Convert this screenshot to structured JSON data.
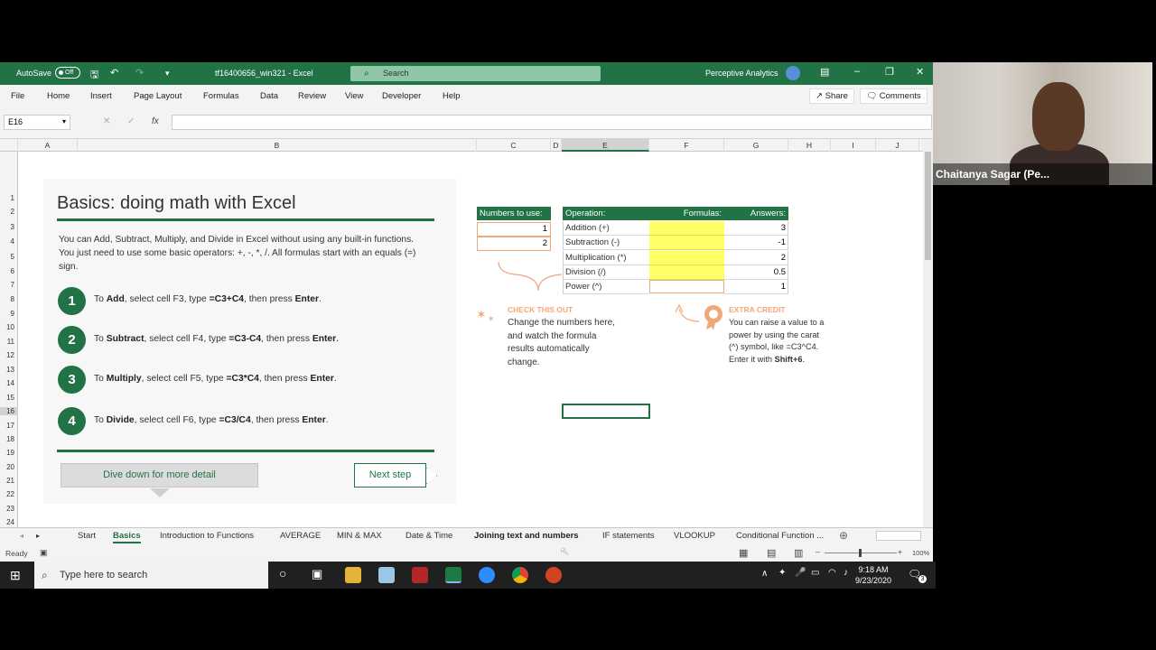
{
  "titlebar": {
    "autosave_label": "AutoSave",
    "autosave_state": "Off",
    "filename": "tf16400656_win321  -  Excel",
    "search_placeholder": "Search",
    "user_name": "Perceptive Analytics"
  },
  "menu": {
    "items": [
      "File",
      "Home",
      "Insert",
      "Page Layout",
      "Formulas",
      "Data",
      "Review",
      "View",
      "Developer",
      "Help"
    ],
    "share_label": "Share",
    "comments_label": "Comments"
  },
  "formula_bar": {
    "name_box": "E16",
    "fx": "fx",
    "value": ""
  },
  "columns": [
    "A",
    "B",
    "C",
    "D",
    "E",
    "F",
    "G",
    "H",
    "I",
    "J"
  ],
  "rows": [
    "1",
    "2",
    "3",
    "4",
    "5",
    "6",
    "7",
    "8",
    "9",
    "10",
    "11",
    "12",
    "13",
    "14",
    "15",
    "16",
    "17",
    "18",
    "19",
    "20",
    "21",
    "22",
    "23",
    "24"
  ],
  "panel": {
    "title": "Basics: doing math with Excel",
    "intro": "You can Add, Subtract, Multiply, and Divide in Excel without using any built-in functions. You just need to use some basic operators: +, -, *, /. All formulas start with an equals (=) sign.",
    "steps": [
      {
        "num": "1",
        "pre": "To ",
        "verb": "Add",
        "mid": ", select cell F3, type ",
        "formula": "=C3+C4",
        "post": ", then press ",
        "key": "Enter",
        "end": "."
      },
      {
        "num": "2",
        "pre": "To ",
        "verb": "Subtract",
        "mid": ", select cell F4, type ",
        "formula": "=C3-C4",
        "post": ", then press ",
        "key": "Enter",
        "end": "."
      },
      {
        "num": "3",
        "pre": "To ",
        "verb": "Multiply",
        "mid": ", select cell F5, type ",
        "formula": "=C3*C4",
        "post": ", then press ",
        "key": "Enter",
        "end": "."
      },
      {
        "num": "4",
        "pre": "To ",
        "verb": "Divide",
        "mid": ", select cell F6, type ",
        "formula": "=C3/C4",
        "post": ", then press ",
        "key": "Enter",
        "end": "."
      }
    ],
    "dive_button": "Dive down for more detail",
    "next_button": "Next step"
  },
  "numbers_table": {
    "header": "Numbers to use:",
    "values": [
      "1",
      "2"
    ]
  },
  "ops_table": {
    "headers": {
      "operation": "Operation:",
      "formulas": "Formulas:",
      "answers": "Answers:"
    },
    "rows": [
      {
        "op": "Addition (+)",
        "answer": "3"
      },
      {
        "op": "Subtraction (-)",
        "answer": "-1"
      },
      {
        "op": "Multiplication (*)",
        "answer": "2"
      },
      {
        "op": "Division (/)",
        "answer": "0.5"
      },
      {
        "op": "Power (^)",
        "answer": "1"
      }
    ]
  },
  "callouts": {
    "check_title": "CHECK THIS OUT",
    "check_lines": [
      "Change the numbers here,",
      "and watch the formula",
      "results automatically",
      "change."
    ],
    "extra_title": "EXTRA CREDIT",
    "extra_lines": [
      "You can raise a value to a",
      "power by using the carat",
      "(^) symbol, like =C3^C4.",
      "Enter it with "
    ],
    "extra_key": "Shift+6",
    "extra_end": "."
  },
  "sheet_tabs": [
    "Start",
    "Basics",
    "Introduction to Functions",
    "AVERAGE",
    "MIN & MAX",
    "Date & Time",
    "Joining text and numbers",
    "IF statements",
    "VLOOKUP",
    "Conditional Function ..."
  ],
  "active_tab": "Basics",
  "status": {
    "ready": "Ready",
    "zoom": "100%"
  },
  "taskbar": {
    "search_placeholder": "Type here to search",
    "time": "9:18 AM",
    "date": "9/23/2020",
    "notifications": "3"
  },
  "webcam": {
    "participant": "Chaitanya Sagar (Pe..."
  },
  "colors": {
    "excel_green": "#217346",
    "formula_yellow": "#ffff66",
    "accent_orange": "#f0a87a"
  }
}
